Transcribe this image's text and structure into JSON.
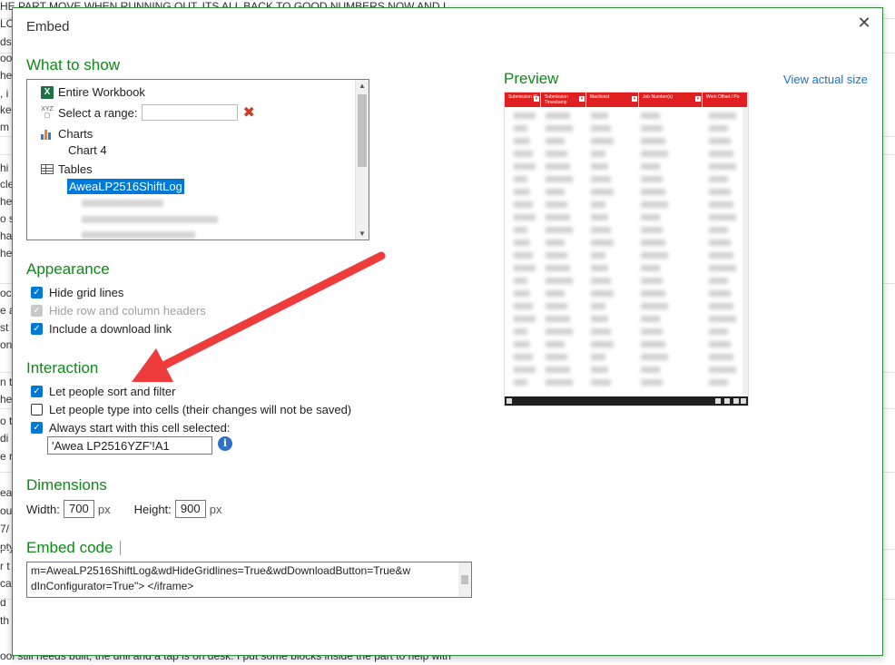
{
  "background_doc": {
    "lines": [
      "HE PART MOVE WHEN RUNNING OUT. ITS ALL BACK TO GOOD NUMBERS NOW AND I",
      "LO",
      "ds",
      "oo",
      "he",
      ", i",
      "ke",
      "m",
      "hi",
      "cle",
      "he",
      "o s",
      "ha",
      "he",
      "oc",
      "e a",
      "st",
      "on",
      "n t",
      "he",
      "o t",
      "di",
      "e ri",
      "ea",
      "ou",
      "7/",
      "pty",
      "r t",
      "ca",
      "d",
      "th",
      "ool still needs built, the drill and a tap is on desk. I put some blocks inside the part to help with"
    ]
  },
  "dialog": {
    "title": "Embed",
    "close_label": "✕",
    "what_to_show": {
      "heading": "What to show",
      "entire_workbook": "Entire Workbook",
      "select_range_label": "Select a range:",
      "select_range_value": "",
      "range_icon_text": "XYZ",
      "clear_range": "✖",
      "charts_label": "Charts",
      "chart_item": "Chart 4",
      "tables_label": "Tables",
      "selected_table": "AweaLP2516ShiftLog"
    },
    "appearance": {
      "heading": "Appearance",
      "options": [
        {
          "label": "Hide grid lines",
          "checked": true,
          "disabled": false
        },
        {
          "label": "Hide row and column headers",
          "checked": true,
          "disabled": true
        },
        {
          "label": "Include a download link",
          "checked": true,
          "disabled": false
        }
      ]
    },
    "interaction": {
      "heading": "Interaction",
      "options": [
        {
          "label": "Let people sort and filter",
          "checked": true
        },
        {
          "label": "Let people type into cells (their changes will not be saved)",
          "checked": false
        },
        {
          "label": "Always start with this cell selected:",
          "checked": true
        }
      ],
      "start_cell_value": "'Awea LP2516YZF'!A1",
      "info_icon": "i"
    },
    "dimensions": {
      "heading": "Dimensions",
      "width_label": "Width:",
      "width_value": "700",
      "width_unit": "px",
      "height_label": "Height:",
      "height_value": "900",
      "height_unit": "px"
    },
    "embed_code": {
      "heading": "Embed code",
      "line1": "m=AweaLP2516ShiftLog&wdHideGridlines=True&wdDownloadButton=True&w",
      "line2": "dInConfigurator=True\"> </iframe>"
    },
    "preview": {
      "heading": "Preview",
      "view_actual_size": "View actual size",
      "columns": [
        "Submission ID",
        "Submission Timestamp",
        "Machinist",
        "Job Number(s)",
        "Work Offset / Po"
      ]
    }
  },
  "colors": {
    "section_heading": "#0e8a16",
    "link": "#1a73c2",
    "checkbox_checked": "#0078d7",
    "annotation_arrow": "#ee3b3b",
    "preview_header": "#e02020"
  }
}
